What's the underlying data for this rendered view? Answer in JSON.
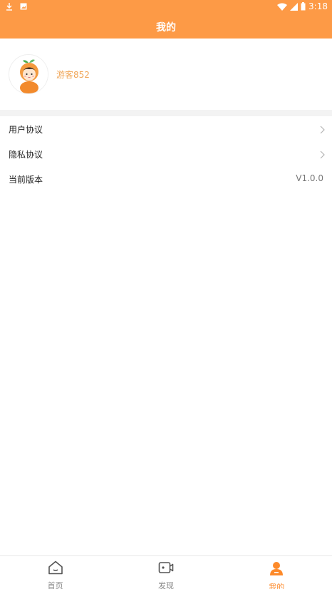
{
  "status_bar": {
    "time": "3:18",
    "icons": [
      "download-icon",
      "image-notification-icon",
      "wifi-icon",
      "signal-icon",
      "battery-icon"
    ]
  },
  "header": {
    "title": "我的"
  },
  "profile": {
    "username": "游客852",
    "avatar": "orange-mascot-avatar"
  },
  "menu": {
    "items": [
      {
        "label": "用户协议",
        "icon": "chevron-right-icon"
      },
      {
        "label": "隐私协议",
        "icon": "chevron-right-icon"
      },
      {
        "label": "当前版本",
        "value": "V1.0.0"
      }
    ]
  },
  "tabbar": {
    "tabs": [
      {
        "label": "首页",
        "icon": "home-icon",
        "active": false
      },
      {
        "label": "发现",
        "icon": "video-icon",
        "active": false
      },
      {
        "label": "我的",
        "icon": "person-icon",
        "active": true
      }
    ]
  },
  "colors": {
    "accent": "#fd9a46",
    "active_tab": "#fd8a2a",
    "username": "#f0a556"
  }
}
